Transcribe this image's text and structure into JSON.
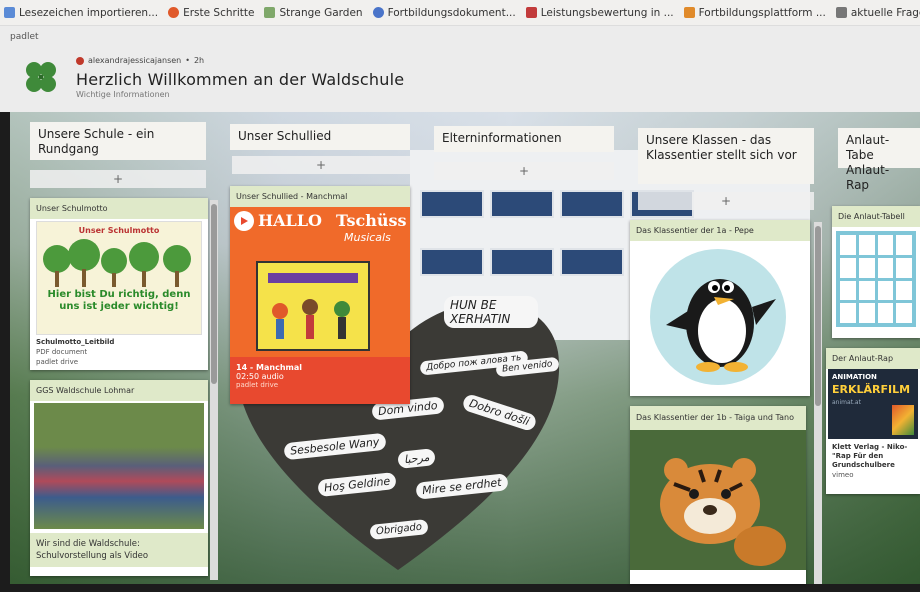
{
  "bookmarks": [
    {
      "label": "Lesezeichen importieren...",
      "color": "#5b8bd6"
    },
    {
      "label": "Erste Schritte",
      "color": "#e0592a"
    },
    {
      "label": "Strange Garden",
      "color": "#7fa86a"
    },
    {
      "label": "Fortbildungsdokument...",
      "color": "#4a74c9"
    },
    {
      "label": "Leistungsbewertung in ...",
      "color": "#c23b3b"
    },
    {
      "label": "Fortbildungsplattform ...",
      "color": "#e08a2a"
    },
    {
      "label": "aktuelle Fragestell",
      "color": "#777777"
    }
  ],
  "header": {
    "brand": "padlet",
    "author": "alexandrajessicajansen",
    "time": "2h",
    "title": "Herzlich Willkommen an der Waldschule",
    "subtitle": "Wichtige Informationen"
  },
  "columns": [
    {
      "title": "Unsere Schule - ein Rundgang"
    },
    {
      "title": "Unser Schullied"
    },
    {
      "title": "Elterninformationen"
    },
    {
      "title": "Unsere Klassen - das Klassentier stellt sich vor"
    },
    {
      "title": "Anlaut-Tabe Anlaut-Rap"
    }
  ],
  "add_label": "+",
  "cards": {
    "schulmotto": {
      "head": "Unser Schulmotto",
      "image_title": "Unser Schulmotto",
      "motto": "Hier bist Du richtig, denn uns ist jeder wichtig!",
      "file": "Schulmotto_Leitbild",
      "type": "PDF document",
      "source": "padlet drive"
    },
    "waldschule": {
      "head": "GGS Waldschule Lohmar",
      "caption": "Wir sind die Waldschule: Schulvorstellung als Video"
    },
    "schullied": {
      "head": "Unser Schullied - Manchmal",
      "album_left": "HALLO",
      "album_right": "Tschüss",
      "album_sub": "Musicals",
      "file": "14 - Manchmal",
      "duration": "02:50 audio",
      "source": "padlet drive"
    },
    "pepe": {
      "head": "Das Klassentier der 1a - Pepe"
    },
    "taiga": {
      "head": "Das Klassentier der 1b - Taiga und Tano"
    },
    "anlaut_tabelle": {
      "head": "Die Anlaut-Tabell"
    },
    "anlaut_rap": {
      "head": "Der Anlaut-Rap",
      "video_top": "ANIMATION",
      "video_title": "ERKLÄRFILM",
      "video_sub": "animat.at",
      "desc": "Klett Verlag - Niko-\"Rap Für den Grundschulbere",
      "source": "vimeo"
    }
  },
  "heart_words": [
    "HUN BE XERHATIN",
    "Dom vindo",
    "Добро пож алова ть",
    "Ben venido",
    "Dobro došli",
    "Sesbesole Wany",
    "مرحبا",
    "Hoş Geldine",
    "Mire se erdhet",
    "Obrigado"
  ],
  "colors": {
    "card_head": "#dfe9c9",
    "schullied_bg": "#e8492f",
    "header_bg": "#ececec"
  }
}
